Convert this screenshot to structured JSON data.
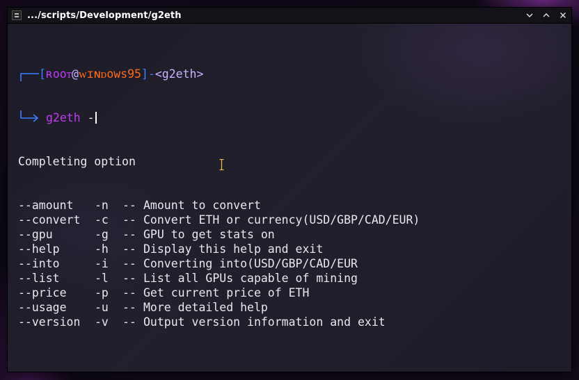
{
  "window": {
    "title": ".../scripts/Development/g2eth",
    "icon": "terminal-icon",
    "buttons": [
      "chevron-down-icon",
      "maximize-icon",
      "close-icon"
    ]
  },
  "prompt": {
    "open_bracket": "[",
    "user": "ʀooᴛ",
    "at": "@",
    "host": "ᴡɪɴᴅows95",
    "close_bracket": "]",
    "dash": "-",
    "dir": "<g2eth>",
    "command": "g2eth",
    "typed": " -"
  },
  "completion": {
    "header": "Completing option",
    "options": [
      {
        "long": "--amount",
        "short": "-n",
        "sep": "--",
        "desc": "Amount to convert"
      },
      {
        "long": "--convert",
        "short": "-c",
        "sep": "--",
        "desc": "Convert ETH or currency(USD/GBP/CAD/EUR)"
      },
      {
        "long": "--gpu",
        "short": "-g",
        "sep": "--",
        "desc": "GPU to get stats on"
      },
      {
        "long": "--help",
        "short": "-h",
        "sep": "--",
        "desc": "Display this help and exit"
      },
      {
        "long": "--into",
        "short": "-i",
        "sep": "--",
        "desc": "Converting into(USD/GBP/CAD/EUR"
      },
      {
        "long": "--list",
        "short": "-l",
        "sep": "--",
        "desc": "List all GPUs capable of mining"
      },
      {
        "long": "--price",
        "short": "-p",
        "sep": "--",
        "desc": "Get current price of ETH"
      },
      {
        "long": "--usage",
        "short": "-u",
        "sep": "--",
        "desc": "More detailed help"
      },
      {
        "long": "--version",
        "short": "-v",
        "sep": "--",
        "desc": "Output version information and exit"
      }
    ]
  },
  "colors": {
    "prompt_line": "#3c80ff",
    "user": "#c03cf0",
    "host": "#ff6b1a",
    "dir": "#c9b4ff",
    "command": "#c03cf0"
  }
}
